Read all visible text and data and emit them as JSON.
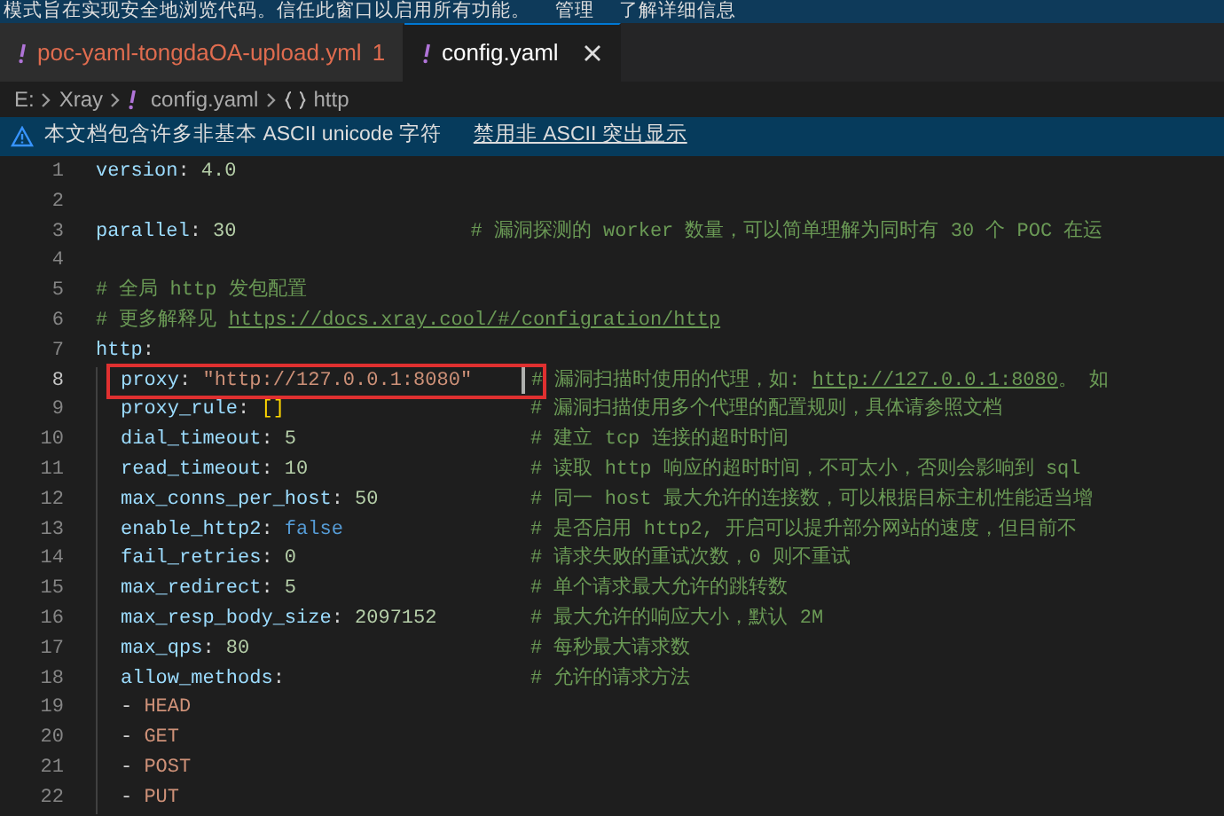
{
  "restricted_banner": {
    "message": "模式旨在实现安全地浏览代码。信任此窗口以启用所有功能。",
    "links": [
      "管理",
      "了解详细信息"
    ]
  },
  "tabs": [
    {
      "label": "poc-yaml-tongdaOA-upload.yml",
      "problems": "1",
      "error": true,
      "selected": false
    },
    {
      "label": "config.yaml",
      "error": false,
      "selected": true
    }
  ],
  "breadcrumb": [
    {
      "kind": "folder",
      "text": "E:"
    },
    {
      "kind": "folder",
      "text": "Xray"
    },
    {
      "kind": "file",
      "text": "config.yaml"
    },
    {
      "kind": "symbol",
      "text": "http"
    }
  ],
  "warning_banner": {
    "message": "本文档包含许多非基本 ASCII unicode 字符",
    "action": "禁用非 ASCII 突出显示"
  },
  "lines": [
    {
      "n": "1",
      "indent": false,
      "tokens": [
        {
          "kind": "key",
          "text": "version"
        },
        {
          "kind": "punct",
          "text": ": "
        },
        {
          "kind": "number",
          "text": "4.0"
        }
      ]
    },
    {
      "n": "2",
      "indent": false
    },
    {
      "n": "3",
      "indent": false,
      "tokens": [
        {
          "kind": "key",
          "text": "parallel"
        },
        {
          "kind": "punct",
          "text": ": "
        },
        {
          "kind": "number",
          "text": "30"
        }
      ],
      "comment": [
        {
          "kind": "text",
          "text": "# 漏洞探测的 worker 数量，可以简单理解为同时有 30 个 POC 在运"
        }
      ]
    },
    {
      "n": "4",
      "indent": false
    },
    {
      "n": "5",
      "indent": false,
      "comment": [
        {
          "kind": "text",
          "text": "# 全局 http 发包配置"
        }
      ]
    },
    {
      "n": "6",
      "indent": false,
      "comment": [
        {
          "kind": "text",
          "text": "# 更多解释见 "
        },
        {
          "kind": "link",
          "text": "https://docs.xray.cool/#/configration/http"
        }
      ]
    },
    {
      "n": "7",
      "indent": false,
      "tokens": [
        {
          "kind": "key",
          "text": "http"
        },
        {
          "kind": "punct",
          "text": ":"
        }
      ]
    },
    {
      "n": "8",
      "indent": true,
      "current": true,
      "highlighted": true,
      "tokens": [
        {
          "kind": "key",
          "text": "proxy"
        },
        {
          "kind": "punct",
          "text": ": "
        },
        {
          "kind": "string",
          "text": "\"http://127.0.0.1:8080\""
        }
      ],
      "comment": [
        {
          "kind": "text",
          "text": "# 漏洞扫描时使用的代理，如: "
        },
        {
          "kind": "link",
          "text": "http://127.0.0.1:8080"
        },
        {
          "kind": "text",
          "text": "。 如"
        }
      ]
    },
    {
      "n": "9",
      "indent": true,
      "tokens": [
        {
          "kind": "key",
          "text": "proxy_rule"
        },
        {
          "kind": "punct",
          "text": ": "
        },
        {
          "kind": "bracket",
          "text": "[]"
        }
      ],
      "comment": [
        {
          "kind": "text",
          "text": "# 漏洞扫描使用多个代理的配置规则，具体请参照文档"
        }
      ]
    },
    {
      "n": "10",
      "indent": true,
      "tokens": [
        {
          "kind": "key",
          "text": "dial_timeout"
        },
        {
          "kind": "punct",
          "text": ": "
        },
        {
          "kind": "number",
          "text": "5"
        }
      ],
      "comment": [
        {
          "kind": "text",
          "text": "# 建立 tcp 连接的超时时间"
        }
      ]
    },
    {
      "n": "11",
      "indent": true,
      "tokens": [
        {
          "kind": "key",
          "text": "read_timeout"
        },
        {
          "kind": "punct",
          "text": ": "
        },
        {
          "kind": "number",
          "text": "10"
        }
      ],
      "comment": [
        {
          "kind": "text",
          "text": "# 读取 http 响应的超时时间，不可太小，否则会影响到 sql"
        }
      ]
    },
    {
      "n": "12",
      "indent": true,
      "tokens": [
        {
          "kind": "key",
          "text": "max_conns_per_host"
        },
        {
          "kind": "punct",
          "text": ": "
        },
        {
          "kind": "number",
          "text": "50"
        }
      ],
      "comment": [
        {
          "kind": "text",
          "text": "# 同一 host 最大允许的连接数，可以根据目标主机性能适当增"
        }
      ]
    },
    {
      "n": "13",
      "indent": true,
      "tokens": [
        {
          "kind": "key",
          "text": "enable_http2"
        },
        {
          "kind": "punct",
          "text": ": "
        },
        {
          "kind": "bool",
          "text": "false"
        }
      ],
      "comment": [
        {
          "kind": "text",
          "text": "# 是否启用 http2, 开启可以提升部分网站的速度，但目前不"
        }
      ]
    },
    {
      "n": "14",
      "indent": true,
      "tokens": [
        {
          "kind": "key",
          "text": "fail_retries"
        },
        {
          "kind": "punct",
          "text": ": "
        },
        {
          "kind": "number",
          "text": "0"
        }
      ],
      "comment": [
        {
          "kind": "text",
          "text": "# 请求失败的重试次数，0 则不重试"
        }
      ]
    },
    {
      "n": "15",
      "indent": true,
      "tokens": [
        {
          "kind": "key",
          "text": "max_redirect"
        },
        {
          "kind": "punct",
          "text": ": "
        },
        {
          "kind": "number",
          "text": "5"
        }
      ],
      "comment": [
        {
          "kind": "text",
          "text": "# 单个请求最大允许的跳转数"
        }
      ]
    },
    {
      "n": "16",
      "indent": true,
      "tokens": [
        {
          "kind": "key",
          "text": "max_resp_body_size"
        },
        {
          "kind": "punct",
          "text": ": "
        },
        {
          "kind": "number",
          "text": "2097152"
        }
      ],
      "comment": [
        {
          "kind": "text",
          "text": "# 最大允许的响应大小，默认 2M"
        }
      ]
    },
    {
      "n": "17",
      "indent": true,
      "tokens": [
        {
          "kind": "key",
          "text": "max_qps"
        },
        {
          "kind": "punct",
          "text": ": "
        },
        {
          "kind": "number",
          "text": "80"
        }
      ],
      "comment": [
        {
          "kind": "text",
          "text": "# 每秒最大请求数"
        }
      ]
    },
    {
      "n": "18",
      "indent": true,
      "tokens": [
        {
          "kind": "key",
          "text": "allow_methods"
        },
        {
          "kind": "punct",
          "text": ":"
        }
      ],
      "comment": [
        {
          "kind": "text",
          "text": "# 允许的请求方法"
        }
      ]
    },
    {
      "n": "19",
      "indent": true,
      "tokens": [
        {
          "kind": "punct",
          "text": "- "
        },
        {
          "kind": "string",
          "text": "HEAD"
        }
      ]
    },
    {
      "n": "20",
      "indent": true,
      "tokens": [
        {
          "kind": "punct",
          "text": "- "
        },
        {
          "kind": "string",
          "text": "GET"
        }
      ]
    },
    {
      "n": "21",
      "indent": true,
      "tokens": [
        {
          "kind": "punct",
          "text": "- "
        },
        {
          "kind": "string",
          "text": "POST"
        }
      ]
    },
    {
      "n": "22",
      "indent": true,
      "tokens": [
        {
          "kind": "punct",
          "text": "- "
        },
        {
          "kind": "string",
          "text": "PUT"
        }
      ]
    }
  ]
}
